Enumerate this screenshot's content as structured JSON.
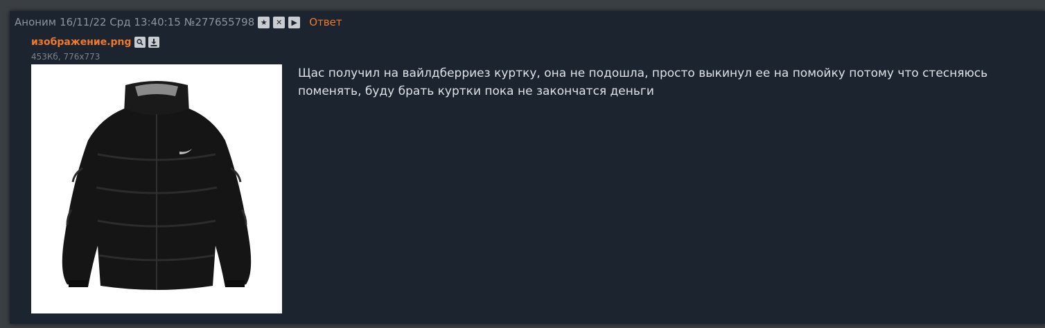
{
  "post": {
    "author": "Аноним",
    "date": "16/11/22 Срд 13:40:15",
    "number": "№277655798",
    "buttons": {
      "favorite_icon": "star-icon",
      "hide_icon": "close-icon",
      "play_icon": "play-icon"
    },
    "reply_label": "Ответ",
    "file": {
      "name": "изображение.png",
      "meta": "453Кб, 776x773",
      "search_icon": "search-icon",
      "download_icon": "download-icon"
    },
    "message": "Щас получил на вайлдберриез куртку, она не подошла, просто выкинул ее на помойку потому что стесняюсь поменять, буду брать куртки пока не закончатся деньги"
  },
  "colors": {
    "page_bg": "#3a3f44",
    "post_bg": "#1c2430",
    "accent": "#f07a2a",
    "text": "#dfe3e7",
    "meta": "#8e949b"
  }
}
